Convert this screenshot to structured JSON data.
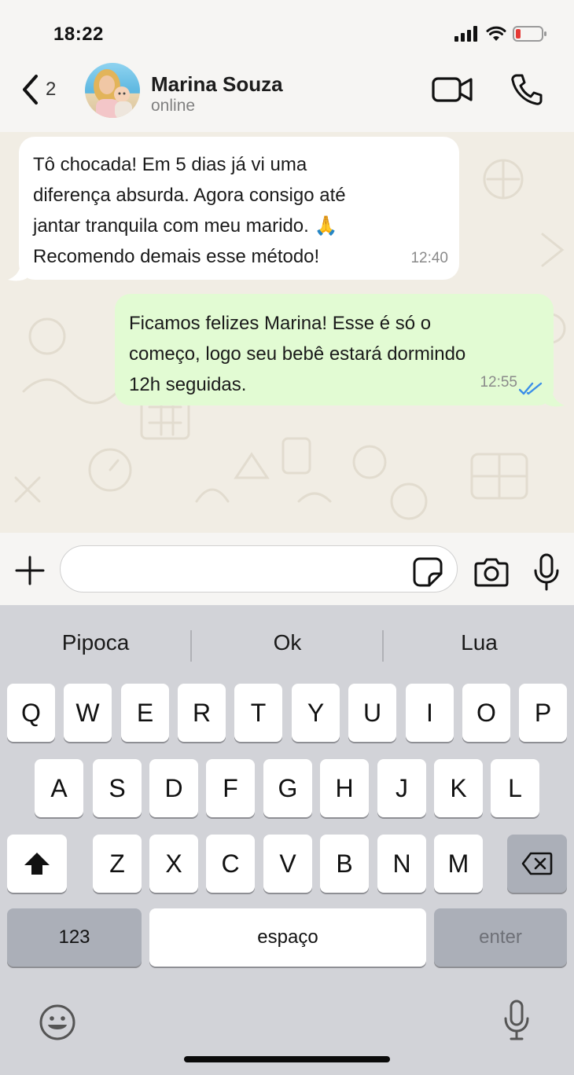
{
  "status_bar": {
    "time": "18:22",
    "battery_color": "#e53935"
  },
  "header": {
    "back_count": "2",
    "contact_name": "Marina Souza",
    "contact_status": "online"
  },
  "messages": [
    {
      "direction": "incoming",
      "text": "Tô chocada! Em 5 dias já vi uma\ndiferença absurda. Agora consigo até\njantar tranquila com meu marido. 🙏\nRecomendo demais esse método!",
      "time": "12:40"
    },
    {
      "direction": "outgoing",
      "text": "Ficamos felizes Marina! Esse é só o\ncomeço, logo seu bebê estará dormindo\n12h seguidas.",
      "time": "12:55",
      "status": "read",
      "tick_color": "#3b8ee8"
    }
  ],
  "input": {
    "placeholder": ""
  },
  "keyboard": {
    "suggestions": [
      "Pipoca",
      "Ok",
      "Lua"
    ],
    "row1": [
      "Q",
      "W",
      "E",
      "R",
      "T",
      "Y",
      "U",
      "I",
      "O",
      "P"
    ],
    "row2": [
      "A",
      "S",
      "D",
      "F",
      "G",
      "H",
      "J",
      "K",
      "L"
    ],
    "row3": [
      "Z",
      "X",
      "C",
      "V",
      "B",
      "N",
      "M"
    ],
    "numbers_label": "123",
    "space_label": "espaço",
    "enter_label": "enter"
  },
  "colors": {
    "incoming_bubble": "#ffffff",
    "outgoing_bubble": "#e2fbd3",
    "chat_background": "#f1ede4",
    "keyboard_background": "#d2d3d8"
  }
}
